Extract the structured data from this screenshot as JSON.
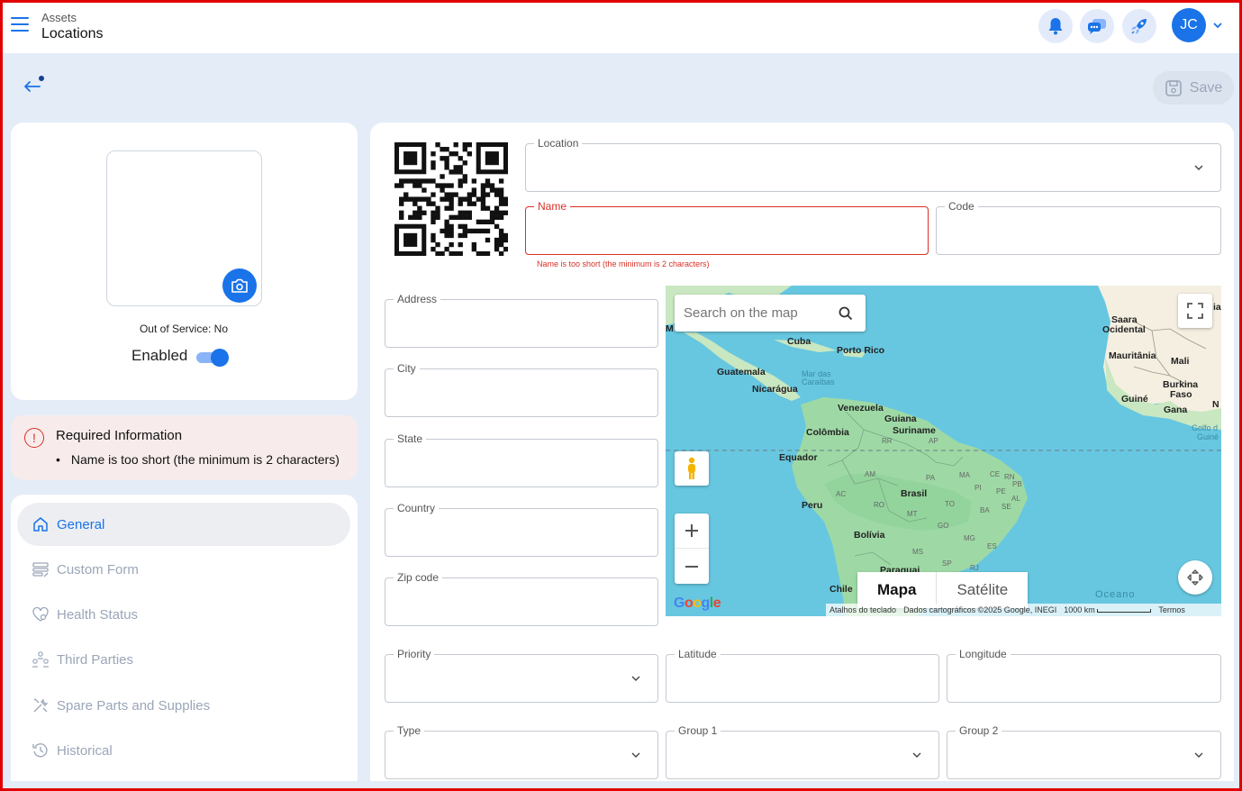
{
  "header": {
    "breadcrumb_parent": "Assets",
    "breadcrumb_current": "Locations",
    "avatar_initials": "JC",
    "icons": [
      "menu-icon",
      "bell-icon",
      "chat-icon",
      "rocket-icon",
      "chevron-down-icon"
    ]
  },
  "toolbar": {
    "save_label": "Save",
    "save_enabled": false
  },
  "profile": {
    "out_of_service": "Out of Service: No",
    "enabled_label": "Enabled",
    "enabled_on": true
  },
  "required_info": {
    "title": "Required Information",
    "items": [
      "Name is too short (the minimum is 2 characters)"
    ]
  },
  "nav": [
    {
      "label": "General",
      "icon": "home-icon",
      "active": true
    },
    {
      "label": "Custom Form",
      "icon": "form-icon",
      "active": false
    },
    {
      "label": "Health Status",
      "icon": "heart-icon",
      "active": false
    },
    {
      "label": "Third Parties",
      "icon": "people-icon",
      "active": false
    },
    {
      "label": "Spare Parts and Supplies",
      "icon": "tools-icon",
      "active": false
    },
    {
      "label": "Historical",
      "icon": "history-icon",
      "active": false
    }
  ],
  "form": {
    "location": {
      "label": "Location",
      "value": ""
    },
    "name": {
      "label": "Name",
      "value": "",
      "error": "Name is too short (the minimum is 2 characters)"
    },
    "code": {
      "label": "Code",
      "value": ""
    },
    "address": {
      "label": "Address",
      "value": ""
    },
    "city": {
      "label": "City",
      "value": ""
    },
    "state": {
      "label": "State",
      "value": ""
    },
    "country": {
      "label": "Country",
      "value": ""
    },
    "zip": {
      "label": "Zip code",
      "value": ""
    },
    "priority": {
      "label": "Priority",
      "value": ""
    },
    "latitude": {
      "label": "Latitude",
      "value": ""
    },
    "longitude": {
      "label": "Longitude",
      "value": ""
    },
    "type": {
      "label": "Type",
      "value": ""
    },
    "group1": {
      "label": "Group 1",
      "value": ""
    },
    "group2": {
      "label": "Group 2",
      "value": ""
    }
  },
  "map": {
    "search_placeholder": "Search on the map",
    "type_map": "Mapa",
    "type_satellite": "Satélite",
    "footer_shortcuts": "Atalhos do teclado",
    "footer_data": "Dados cartográficos ©2025 Google, INEGI",
    "footer_scale": "1000 km",
    "footer_terms": "Termos",
    "google": "Google",
    "labels": {
      "cuba": "Cuba",
      "porto_rico": "Porto Rico",
      "guatemala": "Guatemala",
      "mar_das": "Mar das",
      "caraibas": "Caraíbas",
      "nicaragua": "Nicarágua",
      "venezuela": "Venezuela",
      "guiana": "Guiana",
      "suriname": "Suriname",
      "colombia": "Colômbia",
      "equador": "Equador",
      "peru": "Peru",
      "brasil": "Brasil",
      "bolivia": "Bolívia",
      "paraguai": "Paraguai",
      "chile": "Chile",
      "saara": "Saara",
      "ocidental": "Ocidental",
      "mauritania": "Mauritânia",
      "mali": "Mali",
      "burkina": "Burkina",
      "faso": "Faso",
      "guine": "Guiné",
      "gana": "Gana",
      "golfo": "Golfo d",
      "guine2": "Guiné",
      "oceano": "Oceano",
      "marrocos": "Marrocos",
      "m": "M",
      "n": "N",
      "ia": "ia",
      "am": "AM",
      "pa": "PA",
      "ma": "MA",
      "ce": "CE",
      "rn": "RN",
      "pb": "PB",
      "pi": "PI",
      "pe": "PE",
      "al": "AL",
      "se": "SE",
      "ba": "BA",
      "to": "TO",
      "ac": "AC",
      "ro": "RO",
      "mt": "MT",
      "go": "GO",
      "mg": "MG",
      "es": "ES",
      "ms": "MS",
      "sp": "SP",
      "rj": "RJ",
      "rr": "RR",
      "ap": "AP"
    }
  }
}
